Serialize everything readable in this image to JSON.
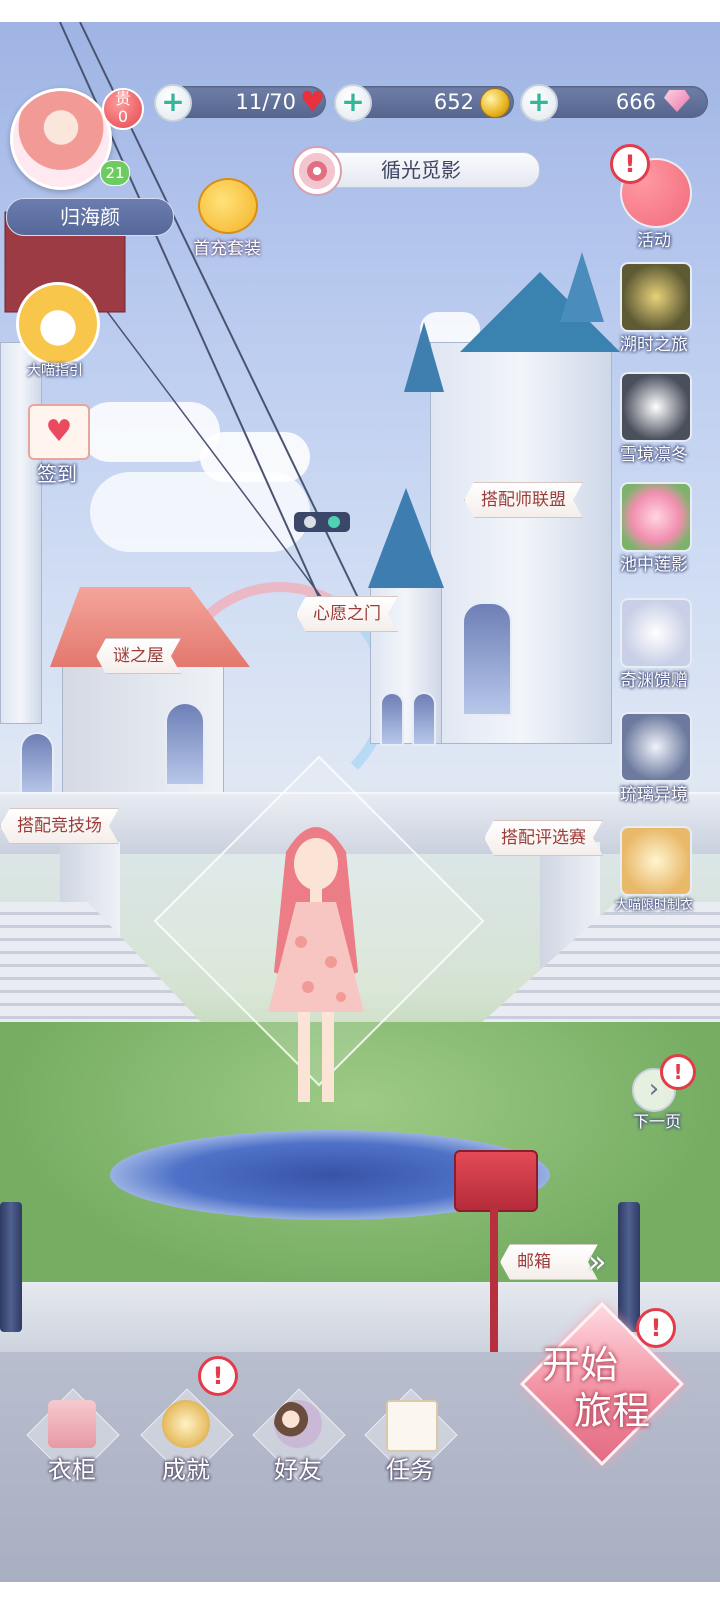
{
  "resources": {
    "stamina": "11/70",
    "coins": "652",
    "diamonds": "666"
  },
  "player": {
    "vip_label": "贵",
    "vip_level": "0",
    "level": "21",
    "name": "归海颜"
  },
  "top": {
    "first_recharge": "首充套装",
    "song_title": "循光觅影"
  },
  "left_menu": {
    "guide": "大喵指引",
    "checkin": "签到"
  },
  "right_menu": [
    {
      "label": "活动",
      "icon": "balloons-icon"
    },
    {
      "label": "溯时之旅",
      "icon": "time-journey-icon"
    },
    {
      "label": "雪境凛冬",
      "icon": "snow-winter-icon"
    },
    {
      "label": "池中莲影",
      "icon": "lotus-icon"
    },
    {
      "label": "奇渊馈赠",
      "icon": "pearl-shell-icon"
    },
    {
      "label": "琉璃异境",
      "icon": "glass-realm-icon"
    },
    {
      "label": "大喵限时制衣",
      "icon": "cat-tailor-icon"
    }
  ],
  "next_page": "下一页",
  "map_signs": {
    "stylist_alliance": "搭配师联盟",
    "wish_gate": "心愿之门",
    "mystery_house": "谜之屋",
    "arena": "搭配竞技场",
    "contest": "搭配评选赛",
    "mailbox": "邮箱"
  },
  "bottom_nav": [
    {
      "label": "衣柜"
    },
    {
      "label": "成就"
    },
    {
      "label": "好友"
    },
    {
      "label": "任务"
    }
  ],
  "start": {
    "line1": "开始",
    "line2": "旅程"
  },
  "colors": {
    "accent_pink": "#e36c84",
    "alert_red": "#e33b49",
    "bar_blue": "#5d6c98"
  }
}
